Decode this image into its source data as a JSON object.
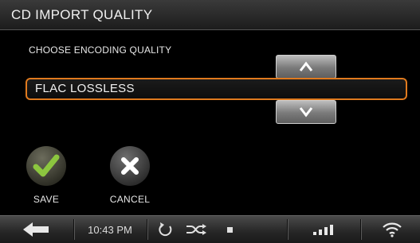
{
  "header": {
    "title": "CD IMPORT QUALITY"
  },
  "settings": {
    "prompt": "CHOOSE ENCODING QUALITY",
    "selected_value": "FLAC LOSSLESS",
    "selection_border_color": "#e07a1e",
    "up_icon": "chevron-up-icon",
    "down_icon": "chevron-down-icon"
  },
  "actions": {
    "save_label": "SAVE",
    "save_icon": "checkmark-icon",
    "save_icon_color": "#8cc63f",
    "cancel_label": "CANCEL",
    "cancel_icon": "x-icon"
  },
  "status_bar": {
    "back_icon": "back-arrow-icon",
    "time": "10:43 PM",
    "repeat_icon": "repeat-icon",
    "shuffle_icon": "shuffle-icon",
    "stop_icon": "stop-icon",
    "signal_icon": "signal-strength-icon",
    "wifi_icon": "wifi-icon"
  }
}
